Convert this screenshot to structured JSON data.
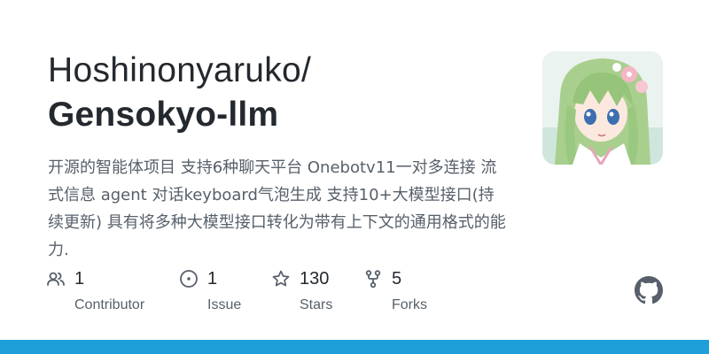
{
  "header": {
    "owner": "Hoshinonyaruko/",
    "repo": "Gensokyo-llm"
  },
  "description": "开源的智能体项目 支持6种聊天平台 Onebotv11一对多连接 流式信息 agent 对话keyboard气泡生成 支持10+大模型接口(持续更新) 具有将多种大模型接口转化为带有上下文的通用格式的能力.",
  "stats": [
    {
      "icon": "people-icon",
      "value": "1",
      "label": "Contributor"
    },
    {
      "icon": "issue-icon",
      "value": "1",
      "label": "Issue"
    },
    {
      "icon": "star-icon",
      "value": "130",
      "label": "Stars"
    },
    {
      "icon": "fork-icon",
      "value": "5",
      "label": "Forks"
    }
  ],
  "colors": {
    "bottom_bar": "#1e9fd9",
    "title": "#24292f",
    "muted": "#57606a"
  }
}
